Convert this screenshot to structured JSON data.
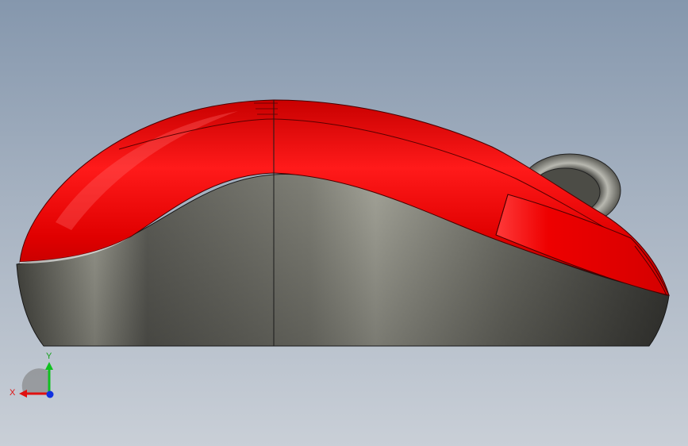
{
  "viewport": {
    "background_top": "#8597ad",
    "background_bottom": "#c9cfd7"
  },
  "model": {
    "name": "mouse-model",
    "shell_color": "#ee0000",
    "base_color": "#6e6e66",
    "wheel_color": "#9a9a92"
  },
  "triad": {
    "x_label": "X",
    "y_label": "Y",
    "x_color": "#e01010",
    "y_color": "#10c020",
    "z_color": "#1030e0"
  }
}
